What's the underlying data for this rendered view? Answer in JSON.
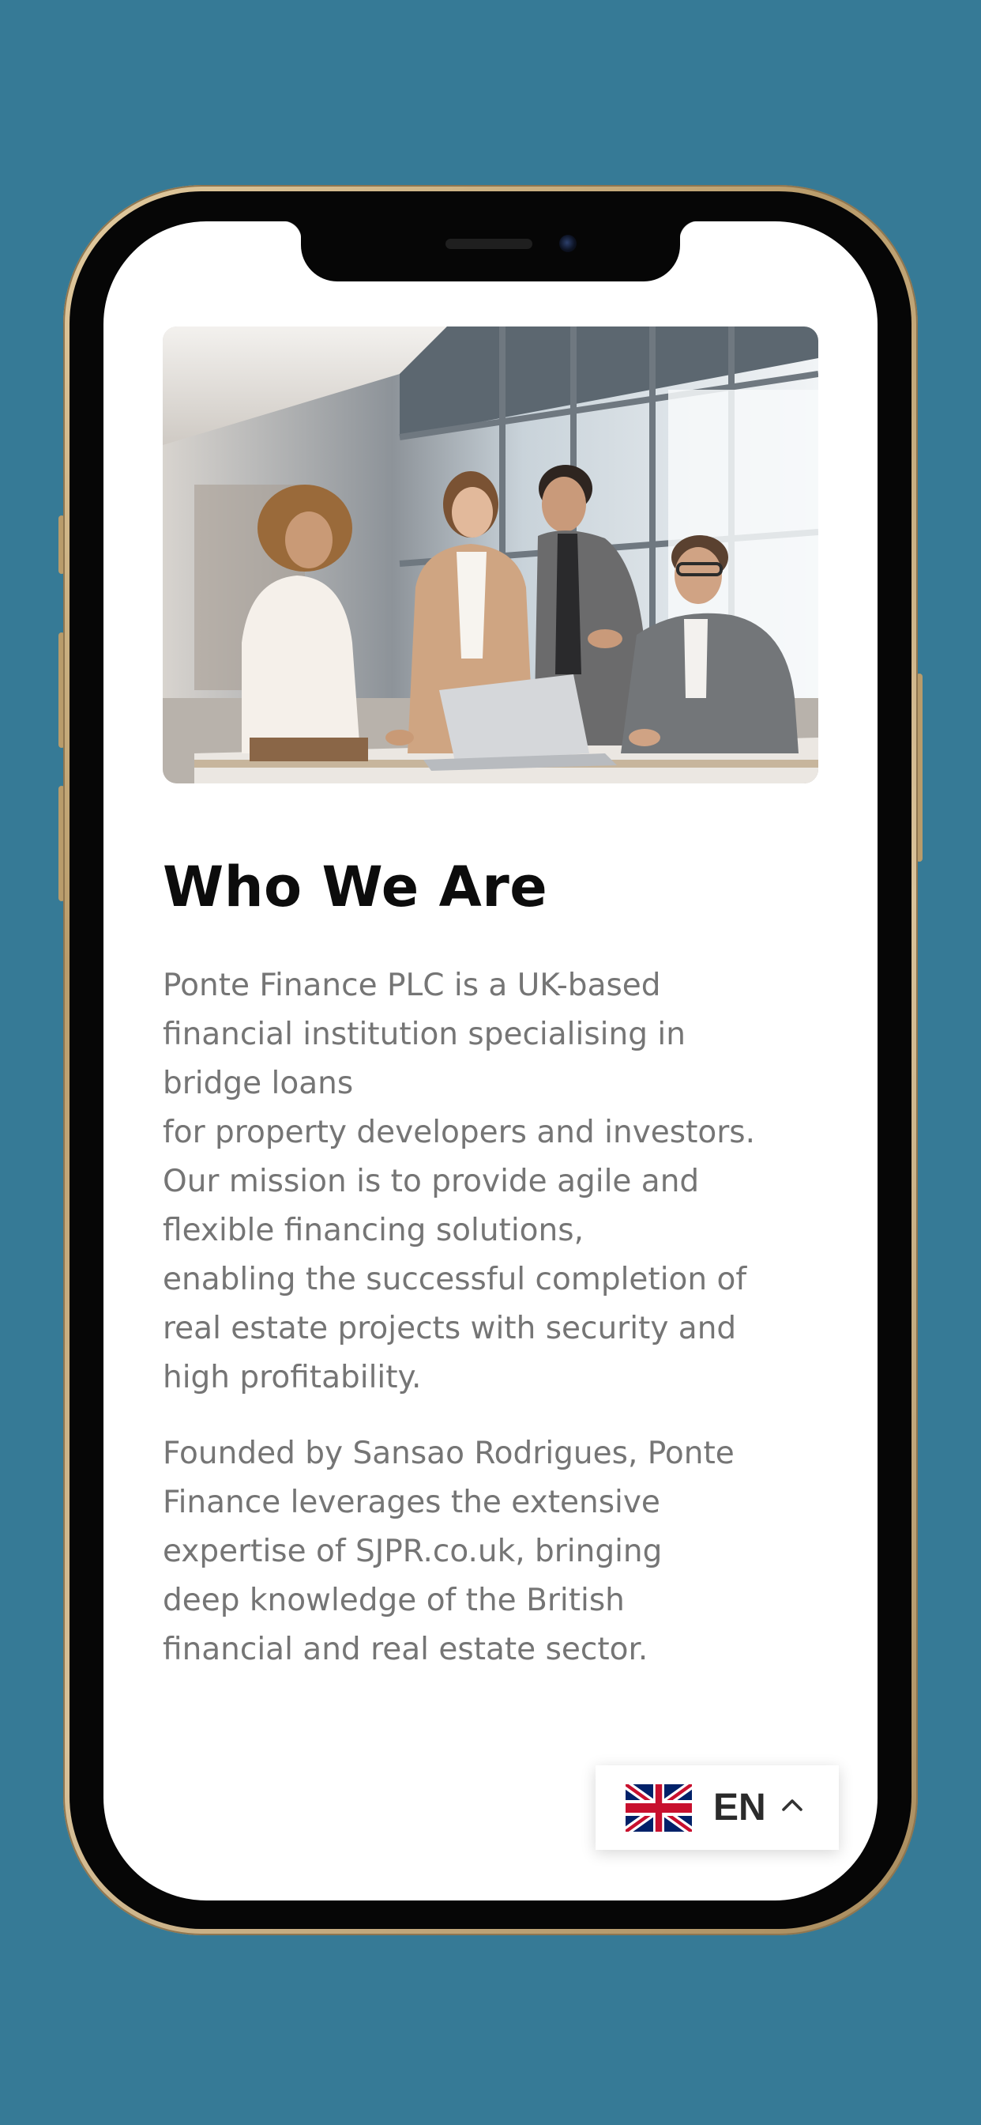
{
  "section": {
    "title": "Who We Are",
    "paragraph_1": "Ponte Finance PLC is a UK-based\nfinancial institution specialising in\nbridge loans\nfor property developers and investors.\nOur mission is to provide agile and\nflexible financing solutions,\nenabling the successful completion of\nreal estate projects with security and\nhigh profitability.",
    "paragraph_2": "Founded by Sansao Rodrigues, Ponte\nFinance leverages the extensive\nexpertise of SJPR.co.uk, bringing\ndeep knowledge of the British\nfinancial and real estate sector."
  },
  "hero_image": {
    "subject": "business-team-meeting-photo"
  },
  "language_selector": {
    "code": "EN",
    "flag_icon": "uk-flag-icon",
    "chevron_icon": "chevron-up-icon"
  },
  "colors": {
    "background": "#367a96",
    "screen": "#ffffff",
    "title": "#0c0c0c",
    "body_text": "#757575",
    "frame_gold": "#c9ae7e"
  }
}
